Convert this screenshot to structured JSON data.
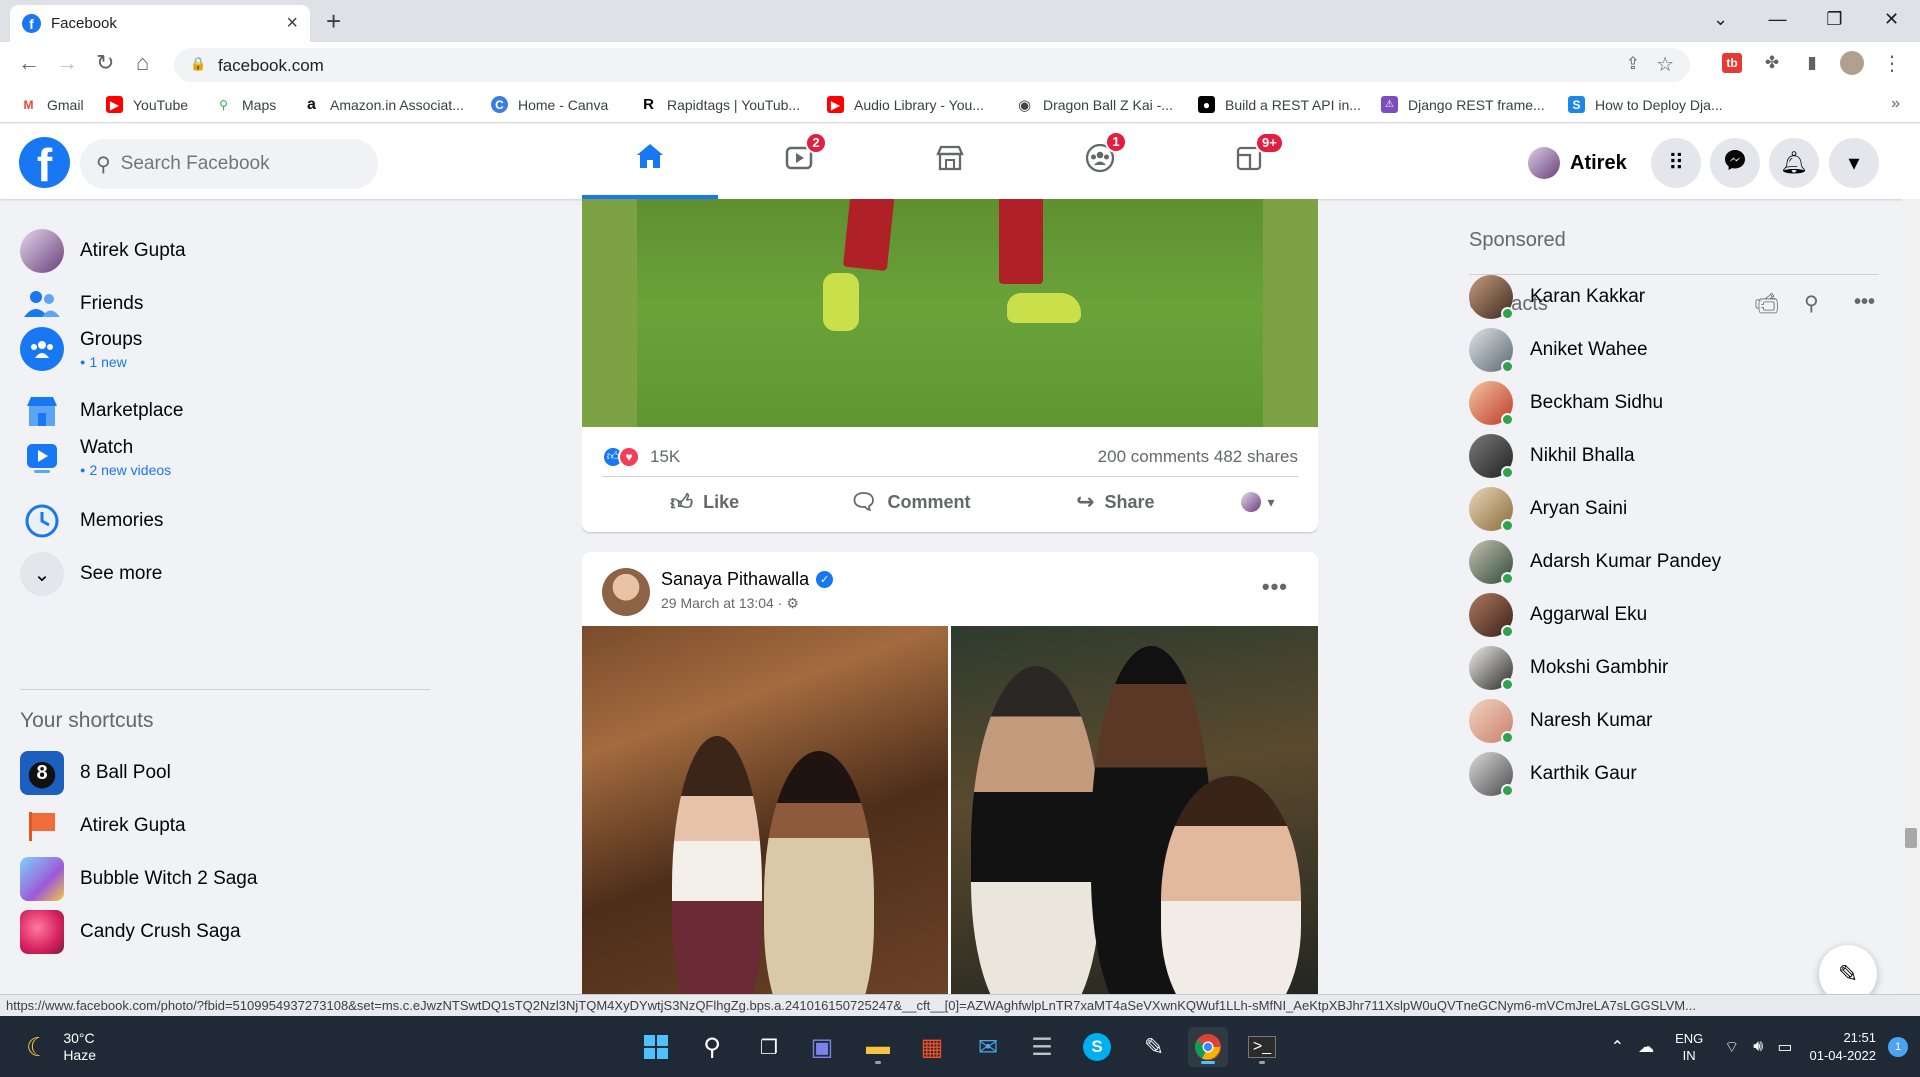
{
  "browser": {
    "tab_title": "Facebook",
    "url": "facebook.com",
    "bookmarks": [
      {
        "label": "Gmail",
        "color": "#ea4335",
        "glyph": "M"
      },
      {
        "label": "YouTube",
        "color": "#ff0000",
        "glyph": "▶"
      },
      {
        "label": "Maps",
        "color": "#34a853",
        "glyph": "⚲"
      },
      {
        "label": "Amazon.in Associat...",
        "color": "#111111",
        "glyph": "a"
      },
      {
        "label": "Home - Canva",
        "color": "#3b7de0",
        "glyph": "C"
      },
      {
        "label": "Rapidtags | YouTub...",
        "color": "#000000",
        "glyph": "R"
      },
      {
        "label": "Audio Library - You...",
        "color": "#ff0000",
        "glyph": "▶"
      },
      {
        "label": "Dragon Ball Z Kai -...",
        "color": "#444444",
        "glyph": "◉"
      },
      {
        "label": "Build a REST API in...",
        "color": "#000000",
        "glyph": "●"
      },
      {
        "label": "Django REST frame...",
        "color": "#7c4dbe",
        "glyph": "⚠"
      },
      {
        "label": "How to Deploy Dja...",
        "color": "#1e88e5",
        "glyph": "S"
      }
    ]
  },
  "header": {
    "search_placeholder": "Search Facebook",
    "profile_name": "Atirek",
    "nav": [
      {
        "name": "home-icon",
        "badge": ""
      },
      {
        "name": "watch-icon",
        "badge": "2"
      },
      {
        "name": "marketplace-icon",
        "badge": ""
      },
      {
        "name": "groups-icon",
        "badge": "1"
      },
      {
        "name": "gaming-icon",
        "badge": "9+"
      }
    ]
  },
  "leftnav": {
    "profile": "Atirek Gupta",
    "friends": "Friends",
    "groups": "Groups",
    "groups_sub": "1 new",
    "marketplace": "Marketplace",
    "watch": "Watch",
    "watch_sub": "2 new videos",
    "memories": "Memories",
    "see_more": "See more",
    "shortcuts_title": "Your shortcuts",
    "shortcuts": [
      "8 Ball Pool",
      "Atirek Gupta",
      "Bubble Witch 2 Saga",
      "Candy Crush Saga"
    ]
  },
  "feed": {
    "post1": {
      "reactions": "15K",
      "comments_shares": "200 comments 482 shares",
      "like": "Like",
      "comment": "Comment",
      "share": "Share"
    },
    "post2": {
      "author": "Sanaya Pithawalla",
      "time": "29 March at 13:04 · ⚙"
    }
  },
  "rightcol": {
    "sponsored": "Sponsored",
    "contacts_title": "Contacts",
    "contacts": [
      "Karan Kakkar",
      "Aniket Wahee",
      "Beckham Sidhu",
      "Nikhil Bhalla",
      "Aryan Saini",
      "Adarsh Kumar Pandey",
      "Aggarwal Eku",
      "Mokshi Gambhir",
      "Naresh Kumar",
      "Karthik Gaur"
    ]
  },
  "status_url": "https://www.facebook.com/photo/?fbid=5109954937273108&set=ms.c.eJwzNTSwtDQ1sTQ2Nzl3NjTQM4XyDYwtjS3NzQFlhgZg.bps.a.241016150725247&__cft__[0]=AZWAghfwlpLnTR7xaMT4aSeVXwnKQWuf1LLh-sMfNI_AeKtpXBJhr711XslpW0uQVTneGCNym6-mVCmJreLA7sLGGSLVM...",
  "taskbar": {
    "temp": "30°C",
    "weather": "Haze",
    "lang1": "ENG",
    "lang2": "IN",
    "time": "21:51",
    "date": "01-04-2022",
    "notif": "1"
  }
}
